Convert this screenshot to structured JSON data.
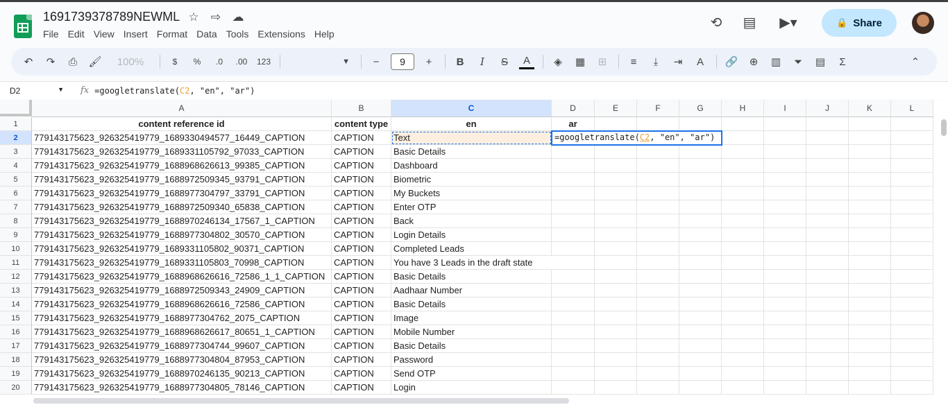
{
  "doc": {
    "title": "1691739378789NEWML",
    "menu": [
      "File",
      "Edit",
      "View",
      "Insert",
      "Format",
      "Data",
      "Tools",
      "Extensions",
      "Help"
    ],
    "share_label": "Share"
  },
  "toolbar": {
    "zoom": "100%",
    "currency": "$",
    "percent": "%",
    "dec_decrease": ".0",
    "dec_increase": ".00",
    "more_formats": "123",
    "font_size": "9",
    "bold": "B",
    "italic": "I",
    "strike": "S",
    "text_color": "A"
  },
  "formula": {
    "cell_ref": "D2",
    "prefix": "=googletranslate(",
    "ref": "C2",
    "suffix": ", \"en\", \"ar\")"
  },
  "sheet": {
    "columns": [
      "A",
      "B",
      "C",
      "D",
      "E",
      "F",
      "G",
      "H",
      "I",
      "J",
      "K",
      "L"
    ],
    "headers": [
      "content reference id",
      "content type",
      "en",
      "ar"
    ],
    "rows": [
      [
        "779143175623_926325419779_1689330494577_16449_CAPTION",
        "CAPTION",
        "Text"
      ],
      [
        "779143175623_926325419779_1689331105792_97033_CAPTION",
        "CAPTION",
        "Basic Details"
      ],
      [
        "779143175623_926325419779_1688968626613_99385_CAPTION",
        "CAPTION",
        "Dashboard"
      ],
      [
        "779143175623_926325419779_1688972509345_93791_CAPTION",
        "CAPTION",
        "Biometric"
      ],
      [
        "779143175623_926325419779_1688977304797_33791_CAPTION",
        "CAPTION",
        "My Buckets"
      ],
      [
        "779143175623_926325419779_1688972509340_65838_CAPTION",
        "CAPTION",
        "Enter OTP"
      ],
      [
        "779143175623_926325419779_1688970246134_17567_1_CAPTION",
        "CAPTION",
        "Back"
      ],
      [
        "779143175623_926325419779_1688977304802_30570_CAPTION",
        "CAPTION",
        "Login Details"
      ],
      [
        "779143175623_926325419779_1689331105802_90371_CAPTION",
        "CAPTION",
        "Completed Leads"
      ],
      [
        "779143175623_926325419779_1689331105803_70998_CAPTION",
        "CAPTION",
        "You have 3 Leads in the draft state"
      ],
      [
        "779143175623_926325419779_1688968626616_72586_1_1_CAPTION",
        "CAPTION",
        "Basic Details"
      ],
      [
        "779143175623_926325419779_1688972509343_24909_CAPTION",
        "CAPTION",
        "Aadhaar Number"
      ],
      [
        "779143175623_926325419779_1688968626616_72586_CAPTION",
        "CAPTION",
        "Basic Details"
      ],
      [
        "779143175623_926325419779_1688977304762_2075_CAPTION",
        "CAPTION",
        "Image"
      ],
      [
        "779143175623_926325419779_1688968626617_80651_1_CAPTION",
        "CAPTION",
        "Mobile Number"
      ],
      [
        "779143175623_926325419779_1688977304744_99607_CAPTION",
        "CAPTION",
        "Basic Details"
      ],
      [
        "779143175623_926325419779_1688977304804_87953_CAPTION",
        "CAPTION",
        "Password"
      ],
      [
        "779143175623_926325419779_1688970246135_90213_CAPTION",
        "CAPTION",
        "Send OTP"
      ],
      [
        "779143175623_926325419779_1688977304805_78146_CAPTION",
        "CAPTION",
        "Login"
      ]
    ],
    "active_cell_text": "=googletranslate(C2, \"en\", \"ar\")"
  },
  "icons": {
    "star": "☆",
    "move": "⇨",
    "cloud": "☁",
    "history": "⟲",
    "comment": "▤",
    "meet": "▶▾",
    "lock": "🔒",
    "undo": "↶",
    "redo": "↷",
    "print": "⎙",
    "paint": "🖌",
    "minus": "−",
    "plus": "+",
    "fill": "◈",
    "borders": "▦",
    "merge": "⊞",
    "align": "≡",
    "valign": "⤓",
    "wrap": "⇥",
    "rotate": "A",
    "link": "🔗",
    "addcomment": "⊕",
    "chart": "▥",
    "filter": "⏷",
    "views": "▤",
    "sigma": "Σ",
    "collapse": "⌃"
  },
  "colors": {
    "accent": "#1a73e8",
    "share_bg": "#c2e7ff",
    "ref": "#e8a33a"
  }
}
